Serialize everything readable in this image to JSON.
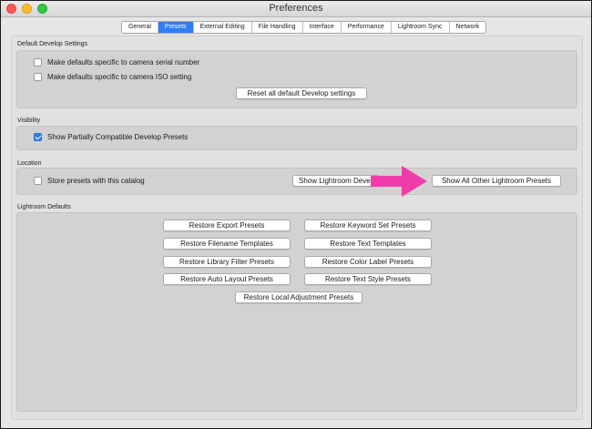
{
  "window": {
    "title": "Preferences"
  },
  "tabs": [
    {
      "label": "General"
    },
    {
      "label": "Presets"
    },
    {
      "label": "External Editing"
    },
    {
      "label": "File Handling"
    },
    {
      "label": "Interface"
    },
    {
      "label": "Performance"
    },
    {
      "label": "Lightroom Sync"
    },
    {
      "label": "Network"
    }
  ],
  "active_tab": "Presets",
  "default_develop": {
    "label": "Default Develop Settings",
    "serial_label": "Make defaults specific to camera serial number",
    "serial_checked": false,
    "iso_label": "Make defaults specific to camera ISO setting",
    "iso_checked": false,
    "reset_button": "Reset all default Develop settings"
  },
  "visibility": {
    "label": "Visibility",
    "show_partial_label": "Show Partially Compatible Develop Presets",
    "show_partial_checked": true
  },
  "location": {
    "label": "Location",
    "store_label": "Store presets with this catalog",
    "store_checked": false,
    "show_develop_button": "Show Lightroom Devel",
    "show_all_button": "Show All Other Lightroom Presets"
  },
  "defaults": {
    "label": "Lightroom Defaults",
    "restore_export": "Restore Export Presets",
    "restore_keyword": "Restore Keyword Set Presets",
    "restore_filename": "Restore Filename Templates",
    "restore_text_templates": "Restore Text Templates",
    "restore_library_filter": "Restore Library Filter Presets",
    "restore_color_label": "Restore Color Label Presets",
    "restore_auto_layout": "Restore Auto Layout Presets",
    "restore_text_style": "Restore Text Style Presets",
    "restore_local_adjustment": "Restore Local Adjustment Presets"
  },
  "colors": {
    "accent": "#2f7ef6",
    "annotation_arrow": "#f03ca8"
  }
}
